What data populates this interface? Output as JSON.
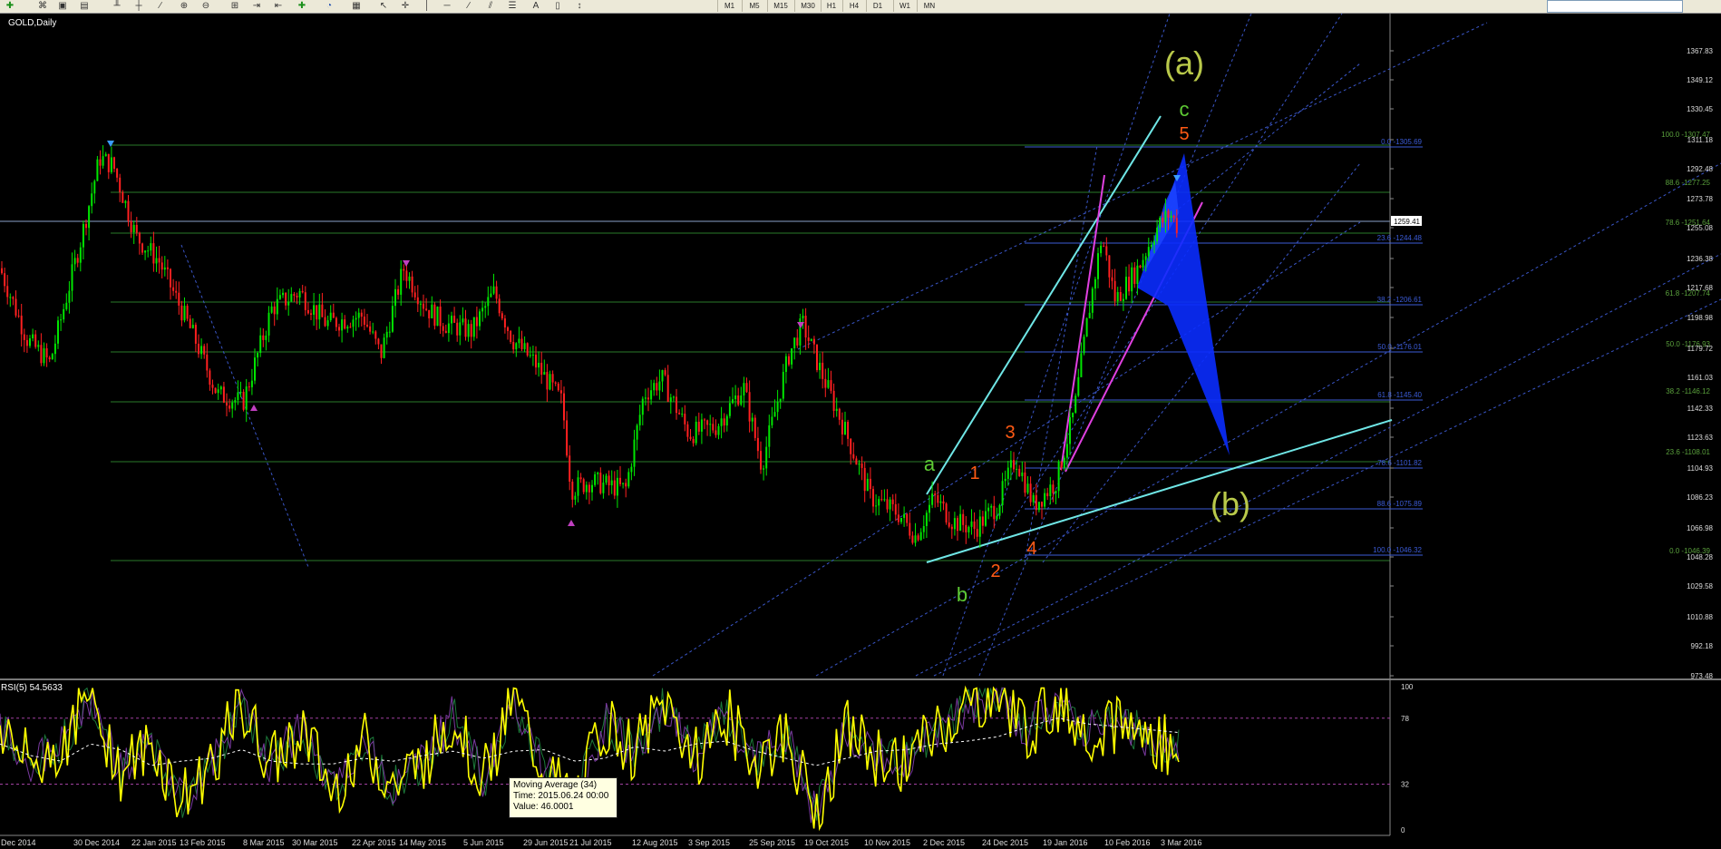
{
  "window": {
    "symbol_title": "GOLD,Daily",
    "rsi_title": "RSI(5) 54.5633"
  },
  "toolbar": {
    "timeframes": [
      "M1",
      "M5",
      "M15",
      "M30",
      "H1",
      "H4",
      "D1",
      "W1",
      "MN"
    ]
  },
  "colors": {
    "background": "#000000",
    "bull": "#00E600",
    "bear": "#FF2020",
    "grid": "#2a7a2a",
    "fib": "#3b5bd6",
    "rsi": "#FFFF00",
    "cyan": "#6FE6E6",
    "magenta": "#E040E0",
    "wave_green": "#5ecb34",
    "wave_orange": "#ff5a14",
    "wave_olive": "#b9c94a"
  },
  "chart_data": [
    {
      "type": "candlestick",
      "title": "GOLD,Daily",
      "x_dates": [
        "Dec 2014",
        "30 Dec 2014",
        "22 Jan 2015",
        "13 Feb 2015",
        "8 Mar 2015",
        "30 Mar 2015",
        "22 Apr 2015",
        "14 May 2015",
        "5 Jun 2015",
        "29 Jun 2015",
        "21 Jul 2015",
        "12 Aug 2015",
        "3 Sep 2015",
        "25 Sep 2015",
        "19 Oct 2015",
        "10 Nov 2015",
        "2 Dec 2015",
        "24 Dec 2015",
        "19 Jan 2016",
        "10 Feb 2016",
        "3 Mar 2016"
      ],
      "price_ticks": [
        "1367.83",
        "1349.12",
        "1330.45",
        "1311.18",
        "1292.48",
        "1273.78",
        "1255.08",
        "1236.38",
        "1217.68",
        "1198.98",
        "1179.72",
        "1161.03",
        "1142.33",
        "1123.63",
        "1104.93",
        "1086.23",
        "1066.98",
        "1048.28",
        "1029.58",
        "1010.88",
        "992.18",
        "973.48"
      ],
      "current_price": "1259.41",
      "ylim": [
        965,
        1380
      ],
      "approx_close_path": [
        [
          "Dec 2014",
          1215
        ],
        [
          "30 Dec 2014",
          1185
        ],
        [
          "22 Jan 2015",
          1300
        ],
        [
          "13 Feb 2015",
          1230
        ],
        [
          "8 Mar 2015",
          1150
        ],
        [
          "30 Mar 2015",
          1205
        ],
        [
          "22 Apr 2015",
          1200
        ],
        [
          "14 May 2015",
          1225
        ],
        [
          "5 Jun 2015",
          1185
        ],
        [
          "29 Jun 2015",
          1170
        ],
        [
          "21 Jul 2015",
          1095
        ],
        [
          "12 Aug 2015",
          1120
        ],
        [
          "3 Sep 2015",
          1125
        ],
        [
          "25 Sep 2015",
          1150
        ],
        [
          "19 Oct 2015",
          1170
        ],
        [
          "10 Nov 2015",
          1085
        ],
        [
          "2 Dec 2015",
          1062
        ],
        [
          "24 Dec 2015",
          1070
        ],
        [
          "19 Jan 2016",
          1100
        ],
        [
          "10 Feb 2016",
          1215
        ],
        [
          "3 Mar 2016",
          1265
        ]
      ],
      "fib_levels_a": [
        {
          "label": "0.0 -1305.69",
          "price": 1305.69
        },
        {
          "label": "23.6 -1244.48",
          "price": 1244.48
        },
        {
          "label": "38.2 -1206.61",
          "price": 1206.61
        },
        {
          "label": "50.0 -1176.01",
          "price": 1176.01
        },
        {
          "label": "61.8 -1145.40",
          "price": 1145.4
        },
        {
          "label": "78.6 -1101.82",
          "price": 1101.82
        },
        {
          "label": "88.6 -1075.89",
          "price": 1075.89
        },
        {
          "label": "100.0 -1046.32",
          "price": 1046.32
        }
      ],
      "fib_levels_b": [
        {
          "label": "100.0 -1307.47",
          "price": 1307.47
        },
        {
          "label": "88.6 -1277.25",
          "price": 1277.25
        },
        {
          "label": "78.6 -1251.64",
          "price": 1251.64
        },
        {
          "label": "61.8 -1207.74",
          "price": 1207.74
        },
        {
          "label": "50.0 -1176.93",
          "price": 1176.93
        },
        {
          "label": "38.2 -1146.12",
          "price": 1146.12
        },
        {
          "label": "23.6 -1108.01",
          "price": 1108.01
        },
        {
          "label": "0.0 -1046.39",
          "price": 1046.39
        }
      ],
      "wave_labels": [
        {
          "text": "(a)",
          "color": "wave_olive",
          "size": 36
        },
        {
          "text": "c",
          "color": "wave_green",
          "size": 22
        },
        {
          "text": "5",
          "color": "wave_orange",
          "size": 20
        },
        {
          "text": "3",
          "color": "wave_orange",
          "size": 20
        },
        {
          "text": "a",
          "color": "wave_green",
          "size": 22
        },
        {
          "text": "1",
          "color": "wave_orange",
          "size": 20
        },
        {
          "text": "(b)",
          "color": "wave_olive",
          "size": 36
        },
        {
          "text": "4",
          "color": "wave_orange",
          "size": 20
        },
        {
          "text": "2",
          "color": "wave_orange",
          "size": 20
        },
        {
          "text": "b",
          "color": "wave_green",
          "size": 22
        }
      ]
    },
    {
      "type": "line",
      "title": "RSI(5) 54.5633",
      "ylim": [
        0,
        100
      ],
      "y_ticks": [
        "100",
        "78",
        "32",
        "0"
      ],
      "series": [
        {
          "name": "RSI(5)",
          "approx_values": [
            72,
            45,
            58,
            95,
            40,
            60,
            20,
            48,
            85,
            45,
            72,
            25,
            62,
            30,
            48,
            80,
            35,
            92,
            40,
            20,
            75,
            55,
            88,
            50,
            80,
            48,
            65,
            10,
            70,
            50,
            48,
            70,
            85,
            96,
            70,
            88,
            70,
            76,
            64,
            56
          ]
        },
        {
          "name": "Moving Average (34)",
          "approx_values": [
            60,
            52,
            48,
            60,
            56,
            45,
            48,
            50,
            56,
            48,
            46,
            46,
            50,
            48,
            52,
            55,
            50,
            55,
            56,
            48,
            50,
            58,
            55,
            60,
            62,
            55,
            50,
            45,
            50,
            55,
            56,
            60,
            62,
            65,
            72,
            78,
            74,
            72,
            70,
            68
          ]
        }
      ]
    }
  ],
  "tooltip": {
    "line1": "Moving Average (34)",
    "line2": "Time: 2015.06.24 00:00",
    "line3": "Value: 46.0001"
  }
}
